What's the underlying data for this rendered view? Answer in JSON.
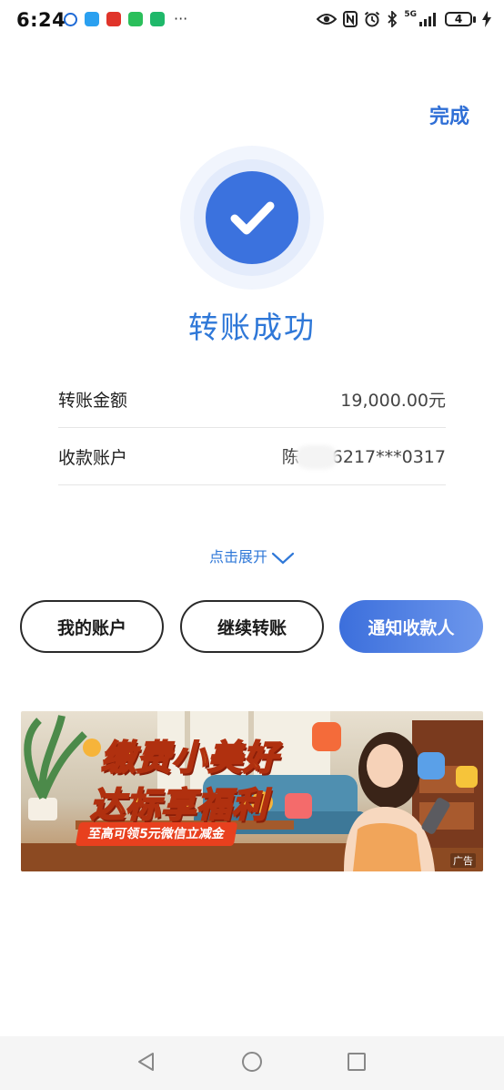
{
  "status_bar": {
    "time": "6:24",
    "network": "5G",
    "battery": "4",
    "apps": [
      {
        "name": "app-c-icon",
        "color": "#1e6ad6"
      },
      {
        "name": "app-chat-icon",
        "color": "#2aa0f0"
      },
      {
        "name": "app-red-icon",
        "color": "#e0342a"
      },
      {
        "name": "wechat-icon",
        "color": "#2bbf5b"
      },
      {
        "name": "app-green-icon",
        "color": "#1fb86a"
      }
    ]
  },
  "header": {
    "done_label": "完成"
  },
  "result": {
    "title": "转账成功"
  },
  "details": [
    {
      "label": "转账金额",
      "value": "19,000.00元"
    },
    {
      "label": "收款账户",
      "value_prefix": "陈",
      "value_suffix": "6217***0317"
    }
  ],
  "expand_label": "点击展开",
  "actions": {
    "my_account": "我的账户",
    "continue_transfer": "继续转账",
    "notify_payee": "通知收款人"
  },
  "ad": {
    "line1": "缴费小美好",
    "line2": "达标享福利",
    "subline": "至高可领5元微信立减金",
    "tag": "广告"
  },
  "colors": {
    "accent": "#2f78d8",
    "primary_button": "#3c6fdc"
  }
}
